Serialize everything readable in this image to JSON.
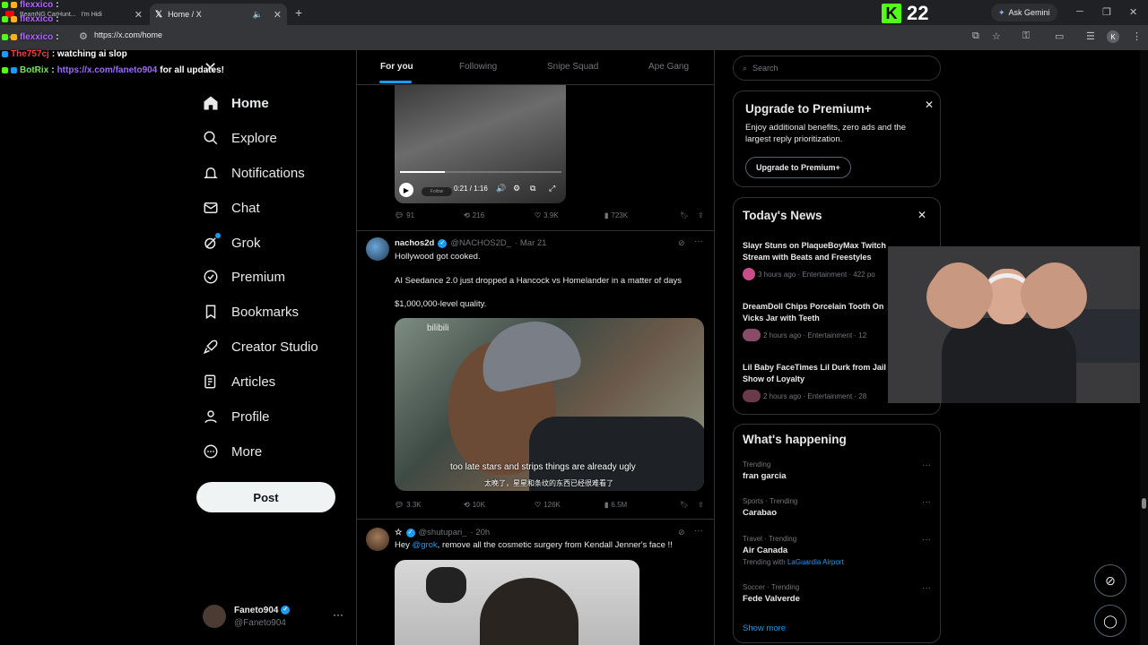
{
  "browser": {
    "tabs": [
      {
        "label": "BeamNG CarHunt...",
        "sub": "I'm Hidi",
        "active": false
      },
      {
        "label": "Home / X",
        "active": true
      }
    ],
    "url": "https://x.com/home",
    "gemini_label": "Ask Gemini",
    "profile_initial": "K"
  },
  "kick": {
    "viewer_count": "22"
  },
  "chat": [
    {
      "user": "flexxico",
      "msg": ""
    },
    {
      "user": "flexxico",
      "msg": ""
    },
    {
      "user": "flexxico",
      "msg": ""
    },
    {
      "user": "The757cj",
      "msg": ": watching ai slop"
    },
    {
      "user": "BotRix",
      "msg": ":",
      "link": "https://x.com/faneto904",
      "tail": "for all updates!"
    }
  ],
  "sidebar": {
    "items": [
      {
        "label": "Home",
        "icon": "home-icon"
      },
      {
        "label": "Explore",
        "icon": "search-icon"
      },
      {
        "label": "Notifications",
        "icon": "bell-icon"
      },
      {
        "label": "Chat",
        "icon": "mail-icon"
      },
      {
        "label": "Grok",
        "icon": "grok-icon"
      },
      {
        "label": "Premium",
        "icon": "premium-icon"
      },
      {
        "label": "Bookmarks",
        "icon": "bookmark-icon"
      },
      {
        "label": "Creator Studio",
        "icon": "rocket-icon"
      },
      {
        "label": "Articles",
        "icon": "article-icon"
      },
      {
        "label": "Profile",
        "icon": "person-icon"
      },
      {
        "label": "More",
        "icon": "more-circle-icon"
      }
    ],
    "post_label": "Post",
    "account": {
      "name": "Faneto904",
      "handle": "@Faneto904"
    }
  },
  "feed": {
    "tabs": [
      "For you",
      "Following",
      "Snipe Squad",
      "Ape Gang"
    ],
    "video": {
      "time": "0:21 / 1:16",
      "follow_label": "Follow",
      "progress": 0.28
    },
    "tweet0_actions": {
      "replies": "91",
      "reposts": "216",
      "likes": "3.9K",
      "views": "723K"
    },
    "tweet1": {
      "name": "nachos2d",
      "handle": "@NACHOS2D_",
      "date": "· Mar 21",
      "lines": [
        "Hollywood got cooked.",
        "AI Seedance 2.0 just dropped a Hancock vs Homelander in a matter of days",
        "$1,000,000-level quality."
      ],
      "subtitle_en": "too late stars and strips things are already ugly",
      "subtitle_cn": "太晚了，星星和条纹的东西已经很难看了",
      "watermark": "bilibili",
      "actions": {
        "replies": "3.3K",
        "reposts": "10K",
        "likes": "126K",
        "views": "6.5M"
      }
    },
    "tweet2": {
      "name": "☆",
      "handle": "@shutupari_",
      "date": "· 20h",
      "text_pre": "Hey ",
      "mention": "@grok",
      "text_post": ", remove all the cosmetic surgery from Kendall Jenner's face !!"
    }
  },
  "right": {
    "search_placeholder": "Search",
    "premium": {
      "title": "Upgrade to Premium+",
      "body": "Enjoy additional benefits, zero ads and the largest reply prioritization.",
      "button": "Upgrade to Premium+"
    },
    "news": {
      "title": "Today's News",
      "items": [
        {
          "title": "Slayr Stuns on PlaqueBoyMax Twitch Stream with Beats and Freestyles",
          "meta": "3 hours ago · Entertainment · 422 po"
        },
        {
          "title": "DreamDoll Chips Porcelain Tooth On Vicks Jar with Teeth",
          "meta": "2 hours ago · Entertainment · 12"
        },
        {
          "title": "Lil Baby FaceTimes Lil Durk from Jail Show of Loyalty",
          "meta": "2 hours ago · Entertainment · 28"
        }
      ]
    },
    "happening": {
      "title": "What's happening",
      "trends": [
        {
          "category": "Trending",
          "name": "fran garcia",
          "with": ""
        },
        {
          "category": "Sports · Trending",
          "name": "Carabao",
          "with": ""
        },
        {
          "category": "Travel · Trending",
          "name": "Air Canada",
          "with_label": "Trending with",
          "with": "LaGuardia Airport"
        },
        {
          "category": "Soccer · Trending",
          "name": "Fede Valverde",
          "with": ""
        }
      ],
      "show_more": "Show more"
    }
  },
  "colors": {
    "accent": "#1d9bf0",
    "kick": "#53fc18",
    "border": "#2f3336",
    "muted": "#71767b"
  }
}
